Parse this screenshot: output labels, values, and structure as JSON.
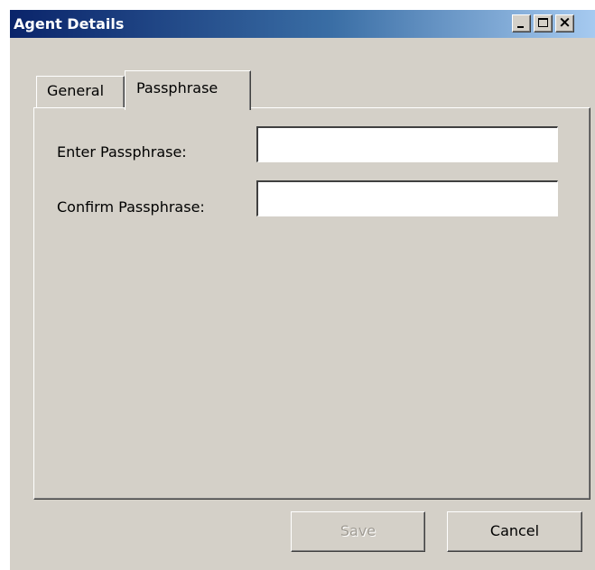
{
  "window": {
    "title": "Agent Details",
    "controls": {
      "minimize": "minimize-icon",
      "maximize": "maximize-icon",
      "close": "close-icon"
    }
  },
  "tabs": [
    {
      "label": "General",
      "active": false
    },
    {
      "label": "Passphrase",
      "active": true
    }
  ],
  "form": {
    "enter_label": "Enter Passphrase:",
    "enter_value": "",
    "confirm_label": "Confirm Passphrase:",
    "confirm_value": ""
  },
  "buttons": {
    "save_label": "Save",
    "save_enabled": false,
    "cancel_label": "Cancel"
  },
  "colors": {
    "face": "#d4d0c8",
    "title_start": "#0a246a",
    "title_end": "#a6caf0"
  }
}
